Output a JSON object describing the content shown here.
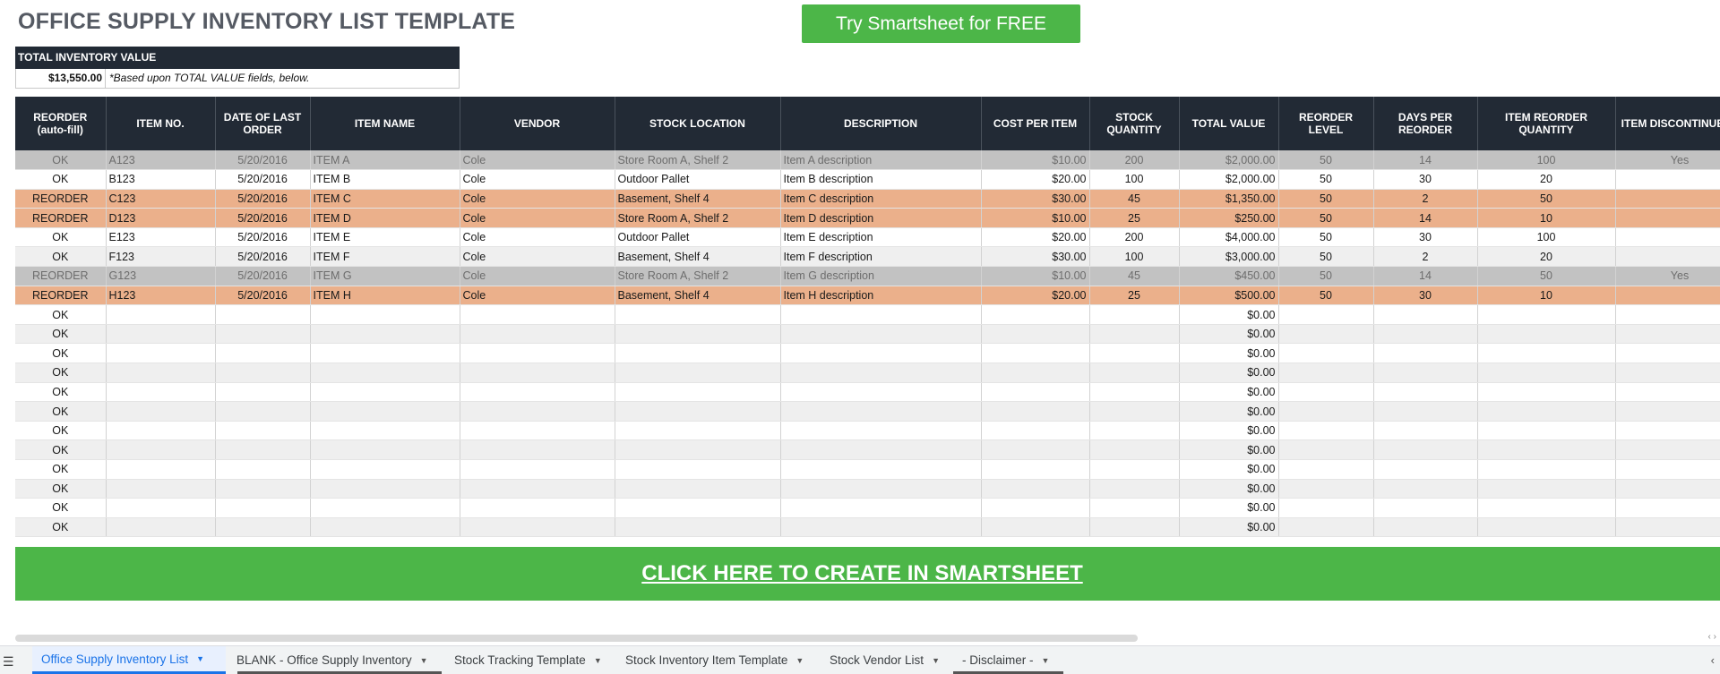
{
  "title": "OFFICE SUPPLY INVENTORY LIST TEMPLATE",
  "try_button": "Try Smartsheet for FREE",
  "tiv": {
    "label": "TOTAL INVENTORY VALUE",
    "value": "$13,550.00",
    "note": "*Based upon TOTAL VALUE fields, below."
  },
  "headers": [
    "REORDER (auto-fill)",
    "ITEM NO.",
    "DATE OF LAST ORDER",
    "ITEM NAME",
    "VENDOR",
    "STOCK LOCATION",
    "DESCRIPTION",
    "COST PER ITEM",
    "STOCK QUANTITY",
    "TOTAL VALUE",
    "REORDER LEVEL",
    "DAYS PER REORDER",
    "ITEM REORDER QUANTITY",
    "ITEM DISCONTINUED?"
  ],
  "rows": [
    [
      "OK",
      "A123",
      "5/20/2016",
      "ITEM A",
      "Cole",
      "Store Room A, Shelf 2",
      "Item A description",
      "$10.00",
      "200",
      "$2,000.00",
      "50",
      "14",
      "100",
      "Yes"
    ],
    [
      "OK",
      "B123",
      "5/20/2016",
      "ITEM B",
      "Cole",
      "Outdoor Pallet",
      "Item B description",
      "$20.00",
      "100",
      "$2,000.00",
      "50",
      "30",
      "20",
      ""
    ],
    [
      "REORDER",
      "C123",
      "5/20/2016",
      "ITEM C",
      "Cole",
      "Basement, Shelf 4",
      "Item C description",
      "$30.00",
      "45",
      "$1,350.00",
      "50",
      "2",
      "50",
      ""
    ],
    [
      "REORDER",
      "D123",
      "5/20/2016",
      "ITEM D",
      "Cole",
      "Store Room A, Shelf 2",
      "Item D description",
      "$10.00",
      "25",
      "$250.00",
      "50",
      "14",
      "10",
      ""
    ],
    [
      "OK",
      "E123",
      "5/20/2016",
      "ITEM E",
      "Cole",
      "Outdoor Pallet",
      "Item E description",
      "$20.00",
      "200",
      "$4,000.00",
      "50",
      "30",
      "100",
      ""
    ],
    [
      "OK",
      "F123",
      "5/20/2016",
      "ITEM F",
      "Cole",
      "Basement, Shelf 4",
      "Item F description",
      "$30.00",
      "100",
      "$3,000.00",
      "50",
      "2",
      "20",
      ""
    ],
    [
      "REORDER",
      "G123",
      "5/20/2016",
      "ITEM G",
      "Cole",
      "Store Room A, Shelf 2",
      "Item G description",
      "$10.00",
      "45",
      "$450.00",
      "50",
      "14",
      "50",
      "Yes"
    ],
    [
      "REORDER",
      "H123",
      "5/20/2016",
      "ITEM H",
      "Cole",
      "Basement, Shelf 4",
      "Item H description",
      "$20.00",
      "25",
      "$500.00",
      "50",
      "30",
      "10",
      ""
    ],
    [
      "OK",
      "",
      "",
      "",
      "",
      "",
      "",
      "",
      "",
      "$0.00",
      "",
      "",
      "",
      ""
    ],
    [
      "OK",
      "",
      "",
      "",
      "",
      "",
      "",
      "",
      "",
      "$0.00",
      "",
      "",
      "",
      ""
    ],
    [
      "OK",
      "",
      "",
      "",
      "",
      "",
      "",
      "",
      "",
      "$0.00",
      "",
      "",
      "",
      ""
    ],
    [
      "OK",
      "",
      "",
      "",
      "",
      "",
      "",
      "",
      "",
      "$0.00",
      "",
      "",
      "",
      ""
    ],
    [
      "OK",
      "",
      "",
      "",
      "",
      "",
      "",
      "",
      "",
      "$0.00",
      "",
      "",
      "",
      ""
    ],
    [
      "OK",
      "",
      "",
      "",
      "",
      "",
      "",
      "",
      "",
      "$0.00",
      "",
      "",
      "",
      ""
    ],
    [
      "OK",
      "",
      "",
      "",
      "",
      "",
      "",
      "",
      "",
      "$0.00",
      "",
      "",
      "",
      ""
    ],
    [
      "OK",
      "",
      "",
      "",
      "",
      "",
      "",
      "",
      "",
      "$0.00",
      "",
      "",
      "",
      ""
    ],
    [
      "OK",
      "",
      "",
      "",
      "",
      "",
      "",
      "",
      "",
      "$0.00",
      "",
      "",
      "",
      ""
    ],
    [
      "OK",
      "",
      "",
      "",
      "",
      "",
      "",
      "",
      "",
      "$0.00",
      "",
      "",
      "",
      ""
    ],
    [
      "OK",
      "",
      "",
      "",
      "",
      "",
      "",
      "",
      "",
      "$0.00",
      "",
      "",
      "",
      ""
    ],
    [
      "OK",
      "",
      "",
      "",
      "",
      "",
      "",
      "",
      "",
      "$0.00",
      "",
      "",
      "",
      ""
    ]
  ],
  "row_styles": [
    "gray",
    "white",
    "orange",
    "orange",
    "white",
    "light",
    "gray",
    "orange",
    "white",
    "light",
    "white",
    "light",
    "white",
    "light",
    "white",
    "light",
    "white",
    "light",
    "white",
    "light"
  ],
  "cta": "CLICK HERE TO CREATE IN SMARTSHEET",
  "tabs": [
    {
      "label": "Office Supply Inventory List",
      "active": true
    },
    {
      "label": "BLANK - Office Supply Inventory",
      "active": false
    },
    {
      "label": "Stock Tracking Template",
      "active": false
    },
    {
      "label": "Stock Inventory Item Template",
      "active": false
    },
    {
      "label": "Stock Vendor List",
      "active": false
    },
    {
      "label": "- Disclaimer -",
      "active": false
    }
  ],
  "colors": {
    "header_bg": "#222a35",
    "brand_green": "#4cb648",
    "reorder_orange": "#ebb08b",
    "discontinued_gray": "#c2c2c2",
    "active_tab": "#1a73e8"
  },
  "icons": {
    "sheet_menu": "all-sheets-menu-icon",
    "tab_caret": "caret-down-icon",
    "scroll_right": "chevron-right-icon"
  }
}
